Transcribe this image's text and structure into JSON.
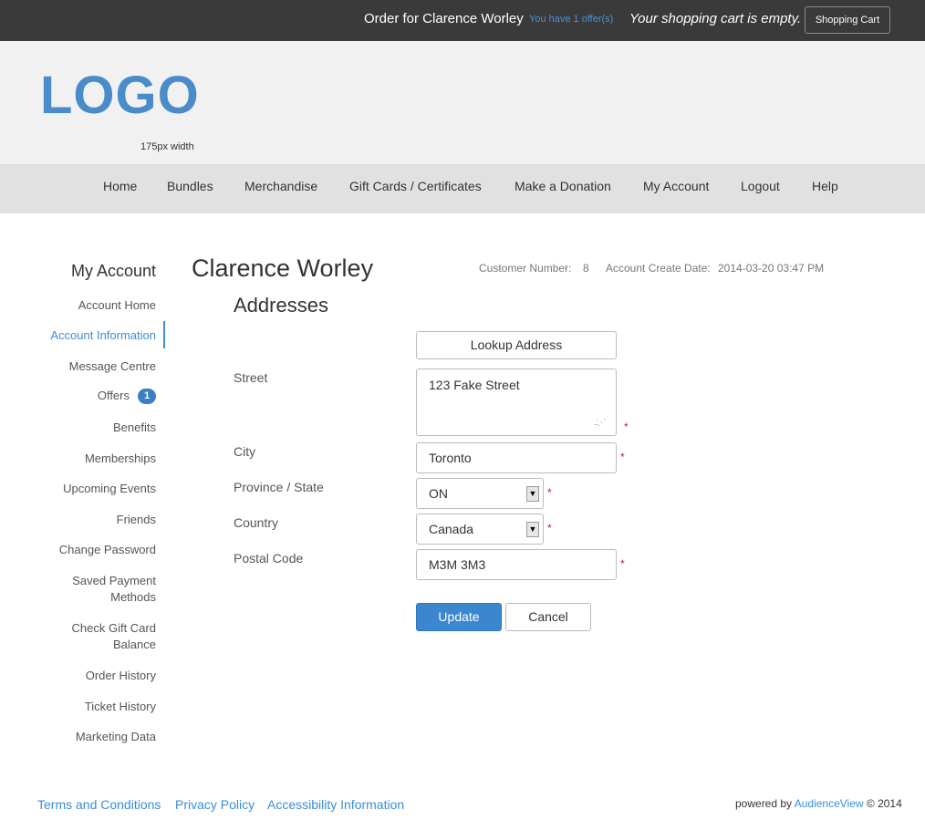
{
  "topbar": {
    "order_text": "Order for Clarence Worley",
    "offers_text": "You have 1 offer(s)",
    "cart_status": "Your shopping cart is empty.",
    "cart_button": "Shopping Cart"
  },
  "header": {
    "logo_text": "LOGO",
    "logo_note": "175px width"
  },
  "nav": {
    "items": [
      "Home",
      "Bundles",
      "Merchandise",
      "Gift Cards / Certificates",
      "Make a Donation",
      "My Account",
      "Logout",
      "Help"
    ]
  },
  "sidebar": {
    "title": "My Account",
    "items": [
      {
        "label": "Account Home"
      },
      {
        "label": "Account Information"
      },
      {
        "label": "Message Centre"
      },
      {
        "label": "Offers",
        "badge": "1"
      },
      {
        "label": "Benefits"
      },
      {
        "label": "Memberships"
      },
      {
        "label": "Upcoming Events"
      },
      {
        "label": "Friends"
      },
      {
        "label": "Change Password"
      },
      {
        "label_line1": "Saved Payment",
        "label_line2": "Methods"
      },
      {
        "label_line1": "Check Gift Card",
        "label_line2": "Balance"
      },
      {
        "label": "Order History"
      },
      {
        "label": "Ticket History"
      },
      {
        "label": "Marketing Data"
      }
    ]
  },
  "main": {
    "customer_name": "Clarence Worley",
    "customer_number_label": "Customer Number:",
    "customer_number": "8",
    "create_date_label": "Account Create Date:",
    "create_date": "2014-03-20 03:47 PM",
    "section_title": "Addresses",
    "lookup_button": "Lookup Address",
    "required_mark": "*",
    "fields": {
      "street_label": "Street",
      "street_value": "123 Fake Street",
      "city_label": "City",
      "city_value": "Toronto",
      "province_label": "Province / State",
      "province_value": "ON",
      "country_label": "Country",
      "country_value": "Canada",
      "postal_label": "Postal Code",
      "postal_value": "M3M 3M3"
    },
    "update_button": "Update",
    "cancel_button": "Cancel"
  },
  "footer": {
    "links": [
      "Terms and Conditions",
      "Privacy Policy",
      "Accessibility Information"
    ],
    "powered_prefix": "powered by",
    "powered_brand": "AudienceView",
    "powered_suffix": "© 2014"
  },
  "colors": {
    "accent": "#3a8dd6",
    "topbar_bg": "#3a3a3a",
    "header_bg": "#f1f1f1",
    "nav_bg": "#e1e1e1",
    "required": "#c02020"
  }
}
